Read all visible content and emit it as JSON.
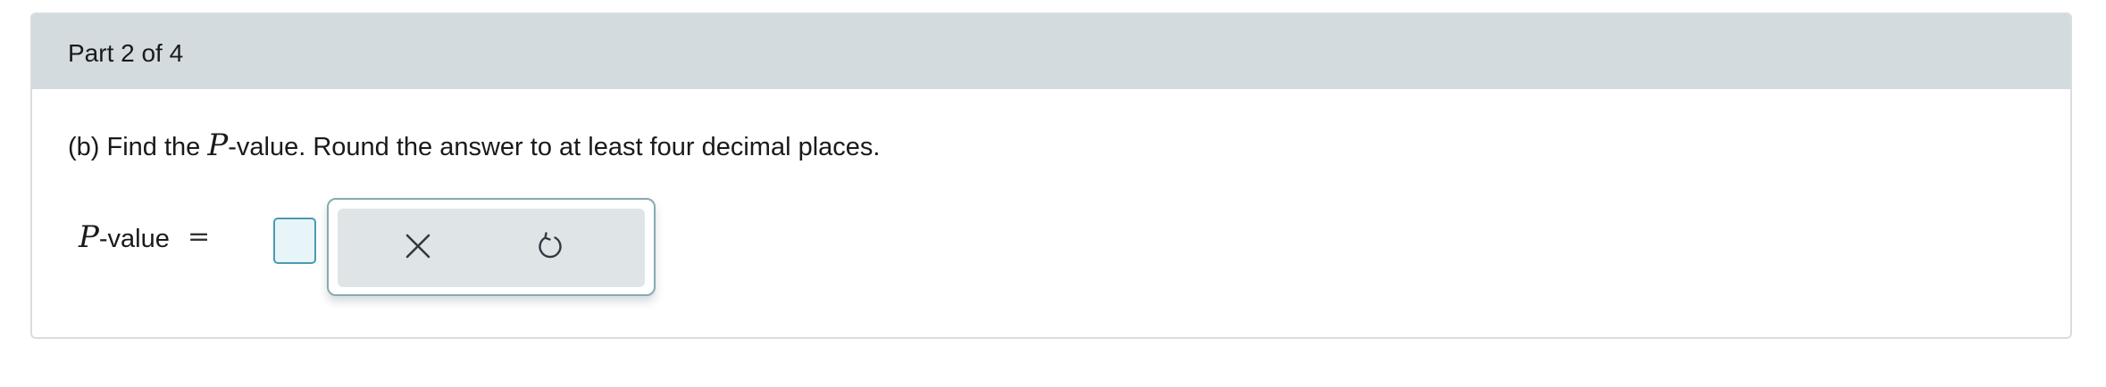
{
  "part": {
    "title": "Part 2 of 4"
  },
  "question": {
    "prefix": "(b) Find the ",
    "variable": "P",
    "suffix": "-value. Round the answer to at least four decimal places."
  },
  "answer": {
    "label_variable": "P",
    "label_suffix": "-value",
    "equals": "=",
    "value": ""
  },
  "toolbar": {
    "buttons": [
      {
        "icon": "close-icon",
        "action": "clear"
      },
      {
        "icon": "undo-icon",
        "action": "undo"
      }
    ]
  },
  "colors": {
    "header_bg": "#d3dbdf",
    "input_border": "#4a9bb1",
    "input_bg": "#e8f5f8",
    "toolbar_bg": "#dfe4e7",
    "icon": "#2f3a40"
  }
}
